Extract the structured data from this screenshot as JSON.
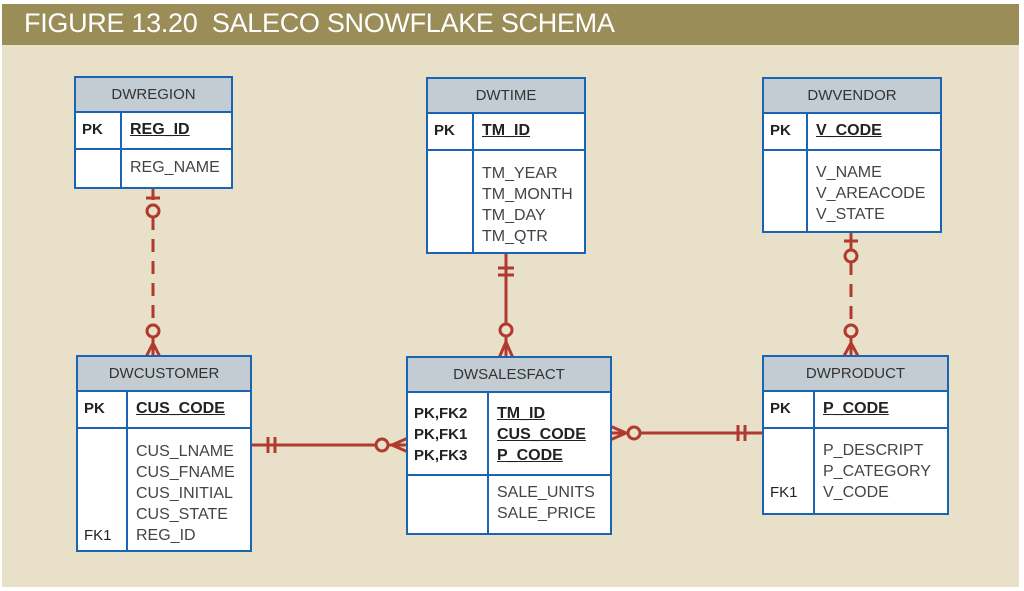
{
  "figure": {
    "title": "FIGURE 13.20  SALECO SNOWFLAKE SCHEMA",
    "colors": {
      "title_bar": "#9a8d57",
      "background": "#e8e0c9",
      "entity_border": "#1a64b4",
      "entity_header": "#c3ccd2",
      "relationship": "#b03a2e"
    }
  },
  "entities": {
    "dwregion": {
      "name": "DWREGION",
      "pk_keys": [
        "PK"
      ],
      "pk_attrs": [
        "REG_ID"
      ],
      "keys": [
        ""
      ],
      "attrs": [
        "REG_NAME"
      ]
    },
    "dwtime": {
      "name": "DWTIME",
      "pk_keys": [
        "PK"
      ],
      "pk_attrs": [
        "TM_ID"
      ],
      "keys": [
        "",
        "",
        "",
        ""
      ],
      "attrs": [
        "TM_YEAR",
        "TM_MONTH",
        "TM_DAY",
        "TM_QTR"
      ]
    },
    "dwvendor": {
      "name": "DWVENDOR",
      "pk_keys": [
        "PK"
      ],
      "pk_attrs": [
        "V_CODE"
      ],
      "keys": [
        "",
        "",
        ""
      ],
      "attrs": [
        "V_NAME",
        "V_AREACODE",
        "V_STATE"
      ]
    },
    "dwcustomer": {
      "name": "DWCUSTOMER",
      "pk_keys": [
        "PK"
      ],
      "pk_attrs": [
        "CUS_CODE"
      ],
      "keys": [
        "",
        "",
        "",
        "",
        "FK1"
      ],
      "attrs": [
        "CUS_LNAME",
        "CUS_FNAME",
        "CUS_INITIAL",
        "CUS_STATE",
        "REG_ID"
      ]
    },
    "dwsalesfact": {
      "name": "DWSALESFACT",
      "pk_keys": [
        "PK,FK2",
        "PK,FK1",
        "PK,FK3"
      ],
      "pk_attrs": [
        "TM_ID",
        "CUS_CODE",
        "P_CODE"
      ],
      "keys": [
        "",
        ""
      ],
      "attrs": [
        "SALE_UNITS",
        "SALE_PRICE"
      ]
    },
    "dwproduct": {
      "name": "DWPRODUCT",
      "pk_keys": [
        "PK"
      ],
      "pk_attrs": [
        "P_CODE"
      ],
      "keys": [
        "",
        "",
        "FK1"
      ],
      "attrs": [
        "P_DESCRIPT",
        "P_CATEGORY",
        "V_CODE"
      ]
    }
  },
  "relationships": [
    {
      "from": "DWREGION",
      "to": "DWCUSTOMER",
      "from_cardinality": "zero-or-one",
      "to_cardinality": "zero-or-many",
      "identifying": false
    },
    {
      "from": "DWTIME",
      "to": "DWSALESFACT",
      "from_cardinality": "one-and-only-one",
      "to_cardinality": "zero-or-many",
      "identifying": true
    },
    {
      "from": "DWVENDOR",
      "to": "DWPRODUCT",
      "from_cardinality": "zero-or-one",
      "to_cardinality": "zero-or-many",
      "identifying": false
    },
    {
      "from": "DWCUSTOMER",
      "to": "DWSALESFACT",
      "from_cardinality": "one-and-only-one",
      "to_cardinality": "zero-or-many",
      "identifying": true
    },
    {
      "from": "DWPRODUCT",
      "to": "DWSALESFACT",
      "from_cardinality": "one-and-only-one",
      "to_cardinality": "zero-or-many",
      "identifying": true
    }
  ]
}
